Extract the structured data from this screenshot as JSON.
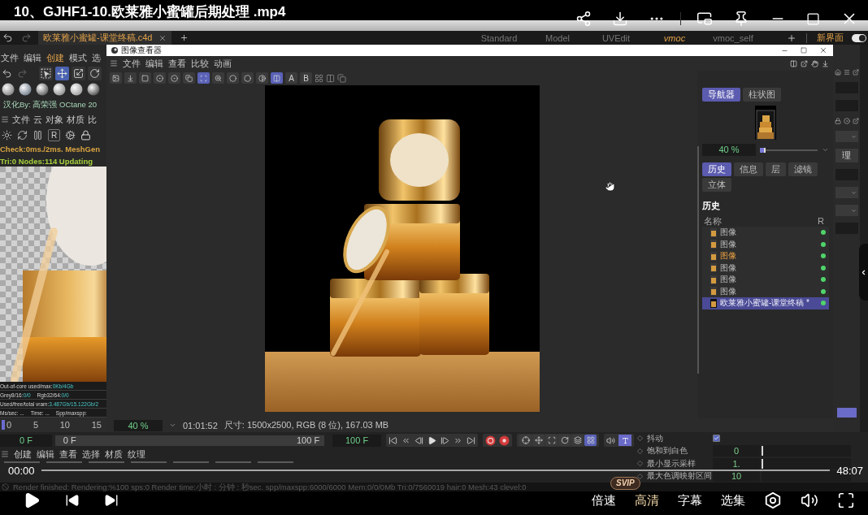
{
  "player": {
    "title": "10、GJHF1-10.欧莱雅小蜜罐后期处理 .mp4",
    "current_time": "00:00",
    "duration": "48:07",
    "speed": "倍速",
    "quality_badge": "SVIP",
    "quality": "高清",
    "subtitles": "字幕",
    "episodes": "选集"
  },
  "app": {
    "document_tab": {
      "label": "欧莱雅小蜜罐-课堂终稿.c4d",
      "selected": true
    },
    "layouts": [
      {
        "label": "Standard",
        "selected": false
      },
      {
        "label": "Model",
        "selected": false
      },
      {
        "label": "UVEdit",
        "selected": false
      },
      {
        "label": "vmoc",
        "selected": true
      },
      {
        "label": "vmoc_self",
        "selected": false
      }
    ],
    "new_layout": "新界面",
    "layout_toggle": {
      "on": true
    },
    "menu": [
      {
        "label": "文件",
        "selected": false
      },
      {
        "label": "编辑",
        "selected": false
      },
      {
        "label": "创建",
        "selected": true
      },
      {
        "label": "模式",
        "selected": false
      },
      {
        "label": "选",
        "selected": false
      }
    ],
    "tools": [
      {
        "selected": false
      },
      {
        "selected": true
      },
      {
        "selected": false
      },
      {
        "selected": false
      }
    ],
    "credit": "汉化By: 高荣强 OCtane 20",
    "octane_menu": [
      "文件",
      "云",
      "对象",
      "材质",
      "比"
    ],
    "octane_tool_letter": "R",
    "log": [
      {
        "text": "Check:0ms./2ms. MeshGen",
        "color": "#d9a441"
      },
      {
        "text": "Tri:0 Nodes:114 Updating",
        "color": "#a6d13c"
      }
    ],
    "stats": [
      [
        {
          "label": "Out-of-core used/max:",
          "value": "0Kb/4Gb"
        }
      ],
      [
        {
          "label": "Grey8/16:",
          "value": "0/0"
        },
        {
          "label": "Rgb32/64:",
          "value": "0/0"
        }
      ],
      [
        {
          "label": "Used/free/total vram:",
          "value": "3.487Gb/15.122Gb/2"
        }
      ],
      [
        {
          "label": "Ms/sec: ..."
        },
        {
          "label": "Time: ..."
        },
        {
          "label": "Spp/maxspp:"
        }
      ]
    ],
    "ruler": [
      "0",
      "5",
      "10",
      "15"
    ],
    "side_button": "理"
  },
  "viewer": {
    "title": "图像查看器",
    "menu": [
      "文件",
      "编辑",
      "查看",
      "比较",
      "动画"
    ],
    "tools": [
      {
        "selected": false
      },
      {
        "selected": false
      },
      {
        "selected": false
      },
      {
        "selected": false
      },
      {
        "selected": false
      },
      {
        "selected": false
      },
      {
        "selected": true
      },
      {
        "selected": false
      },
      {
        "selected": false
      },
      {
        "selected": false
      },
      {
        "selected": false
      },
      {
        "selected": true
      }
    ],
    "letters": [
      "A",
      "B"
    ],
    "nav_tabs": [
      {
        "label": "导航器",
        "selected": true
      },
      {
        "label": "柱状图",
        "selected": false
      }
    ],
    "zoom": "40 %",
    "zoom_slider": {
      "level": 0.1
    },
    "panel_tabs": [
      {
        "label": "历史",
        "selected": true
      },
      {
        "label": "信息",
        "selected": false
      },
      {
        "label": "层",
        "selected": false
      },
      {
        "label": "滤镜",
        "selected": false
      },
      {
        "label": "立体",
        "selected": false
      }
    ],
    "history_title": "历史",
    "columns": [
      "名称",
      "R"
    ],
    "history": [
      {
        "label": "图像",
        "active": false,
        "selected": false
      },
      {
        "label": "图像",
        "active": false,
        "selected": false
      },
      {
        "label": "图像",
        "active": true,
        "selected": false
      },
      {
        "label": "图像",
        "active": false,
        "selected": false
      },
      {
        "label": "图像",
        "active": false,
        "selected": false
      },
      {
        "label": "图像",
        "active": false,
        "selected": false
      },
      {
        "label": "欧莱雅小蜜罐-课堂终稿 *",
        "active": false,
        "selected": true
      }
    ],
    "status_zoom": "40 %",
    "time": "01:01:52",
    "info": "尺寸: 1500x2500, RGB (8 位), 167.03 MB"
  },
  "timeline": {
    "start": "0 F",
    "range_start": "0 F",
    "range_end": "100 F",
    "end": "100 F",
    "key_tools": [
      {
        "selected": false
      },
      {
        "selected": false
      },
      {
        "selected": false
      },
      {
        "selected": false
      },
      {
        "selected": false
      },
      {
        "selected": true
      }
    ]
  },
  "attributes": [
    {
      "kind": "checkbox",
      "label": "抖动",
      "checked": true
    },
    {
      "kind": "number",
      "label": "饱和到白色",
      "value": "0",
      "level": 0
    },
    {
      "kind": "number",
      "label": "最小显示采样",
      "value": "1.",
      "level": 0
    },
    {
      "kind": "number",
      "label": "最大色调映射区间",
      "value": "10"
    }
  ],
  "material_menu": [
    "创建",
    "编辑",
    "查看",
    "选择",
    "材质",
    "纹理"
  ],
  "status": "Render finished: Rendering:%100 sps:0 Render time:小时 : 分钟 : 秒sec. spp/maxspp:6000/6000 Mem:0/0/0Mb Tri:0/7560019 hair:0 Mesh:43 clevel:0"
}
